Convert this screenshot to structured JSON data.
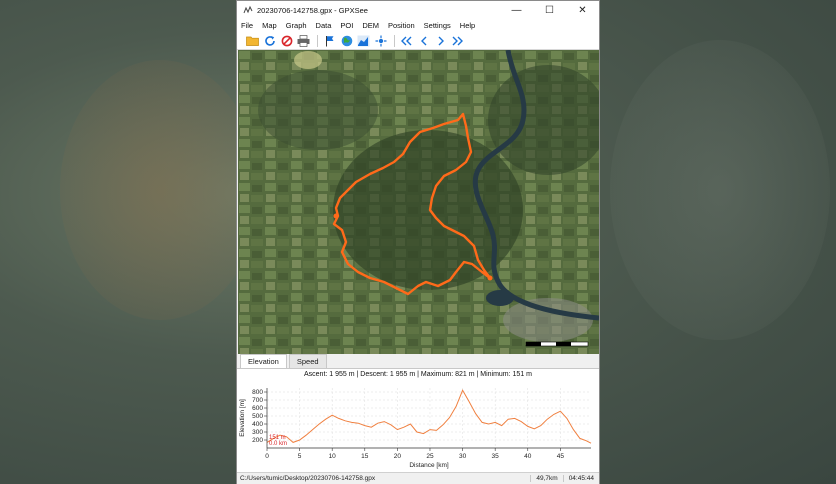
{
  "window": {
    "title": "20230706-142758.gpx - GPXSee",
    "minimize": "—",
    "maximize": "☐",
    "close": "✕"
  },
  "menu": [
    "File",
    "Map",
    "Graph",
    "Data",
    "POI",
    "DEM",
    "Position",
    "Settings",
    "Help"
  ],
  "toolbar_icons": [
    "open-folder-icon",
    "reload-icon",
    "close-file-icon",
    "print-icon",
    "flag-icon",
    "globe-icon",
    "graph-toggle-icon",
    "position-icon",
    "first-file-icon",
    "previous-file-icon",
    "next-file-icon",
    "last-file-icon"
  ],
  "colors": {
    "track": "#ff6a1a",
    "graph_line": "#f08040",
    "accent_blue": "#1a73d9"
  },
  "tabs": [
    "Elevation",
    "Speed"
  ],
  "stats": "Ascent: 1 955 m  |  Descent: 1 955 m  |  Maximum: 821 m  |  Minimum: 151 m",
  "chart_data": {
    "type": "line",
    "xlabel": "Distance [km]",
    "ylabel": "Elevation [m]",
    "xlim": [
      0,
      49.7
    ],
    "ylim": [
      100,
      850
    ],
    "x_ticks": [
      0,
      5,
      10,
      15,
      20,
      25,
      30,
      35,
      40,
      45
    ],
    "y_ticks": [
      200,
      300,
      400,
      500,
      600,
      700,
      800
    ],
    "x": [
      0,
      1,
      2,
      3,
      4,
      5,
      6,
      7,
      8,
      9,
      10,
      11,
      12,
      13,
      14,
      15,
      16,
      17,
      18,
      19,
      20,
      21,
      22,
      23,
      24,
      25,
      26,
      27,
      28,
      29,
      30,
      31,
      32,
      33,
      34,
      35,
      36,
      37,
      38,
      39,
      40,
      41,
      42,
      43,
      44,
      45,
      46,
      47,
      48,
      49,
      49.7
    ],
    "y": [
      170,
      220,
      260,
      240,
      170,
      200,
      260,
      330,
      400,
      460,
      510,
      470,
      440,
      420,
      410,
      380,
      360,
      410,
      430,
      390,
      330,
      360,
      400,
      300,
      280,
      330,
      320,
      390,
      480,
      620,
      821,
      680,
      530,
      420,
      400,
      420,
      380,
      460,
      470,
      430,
      370,
      340,
      380,
      460,
      520,
      560,
      470,
      330,
      220,
      190,
      160
    ],
    "min_marker": {
      "elevation": "151 m",
      "distance": "0.0 km"
    }
  },
  "status": {
    "path": "C:/Users/tumic/Desktop/20230706-142758.gpx",
    "distance": "49,7km",
    "time": "04:45:44"
  }
}
